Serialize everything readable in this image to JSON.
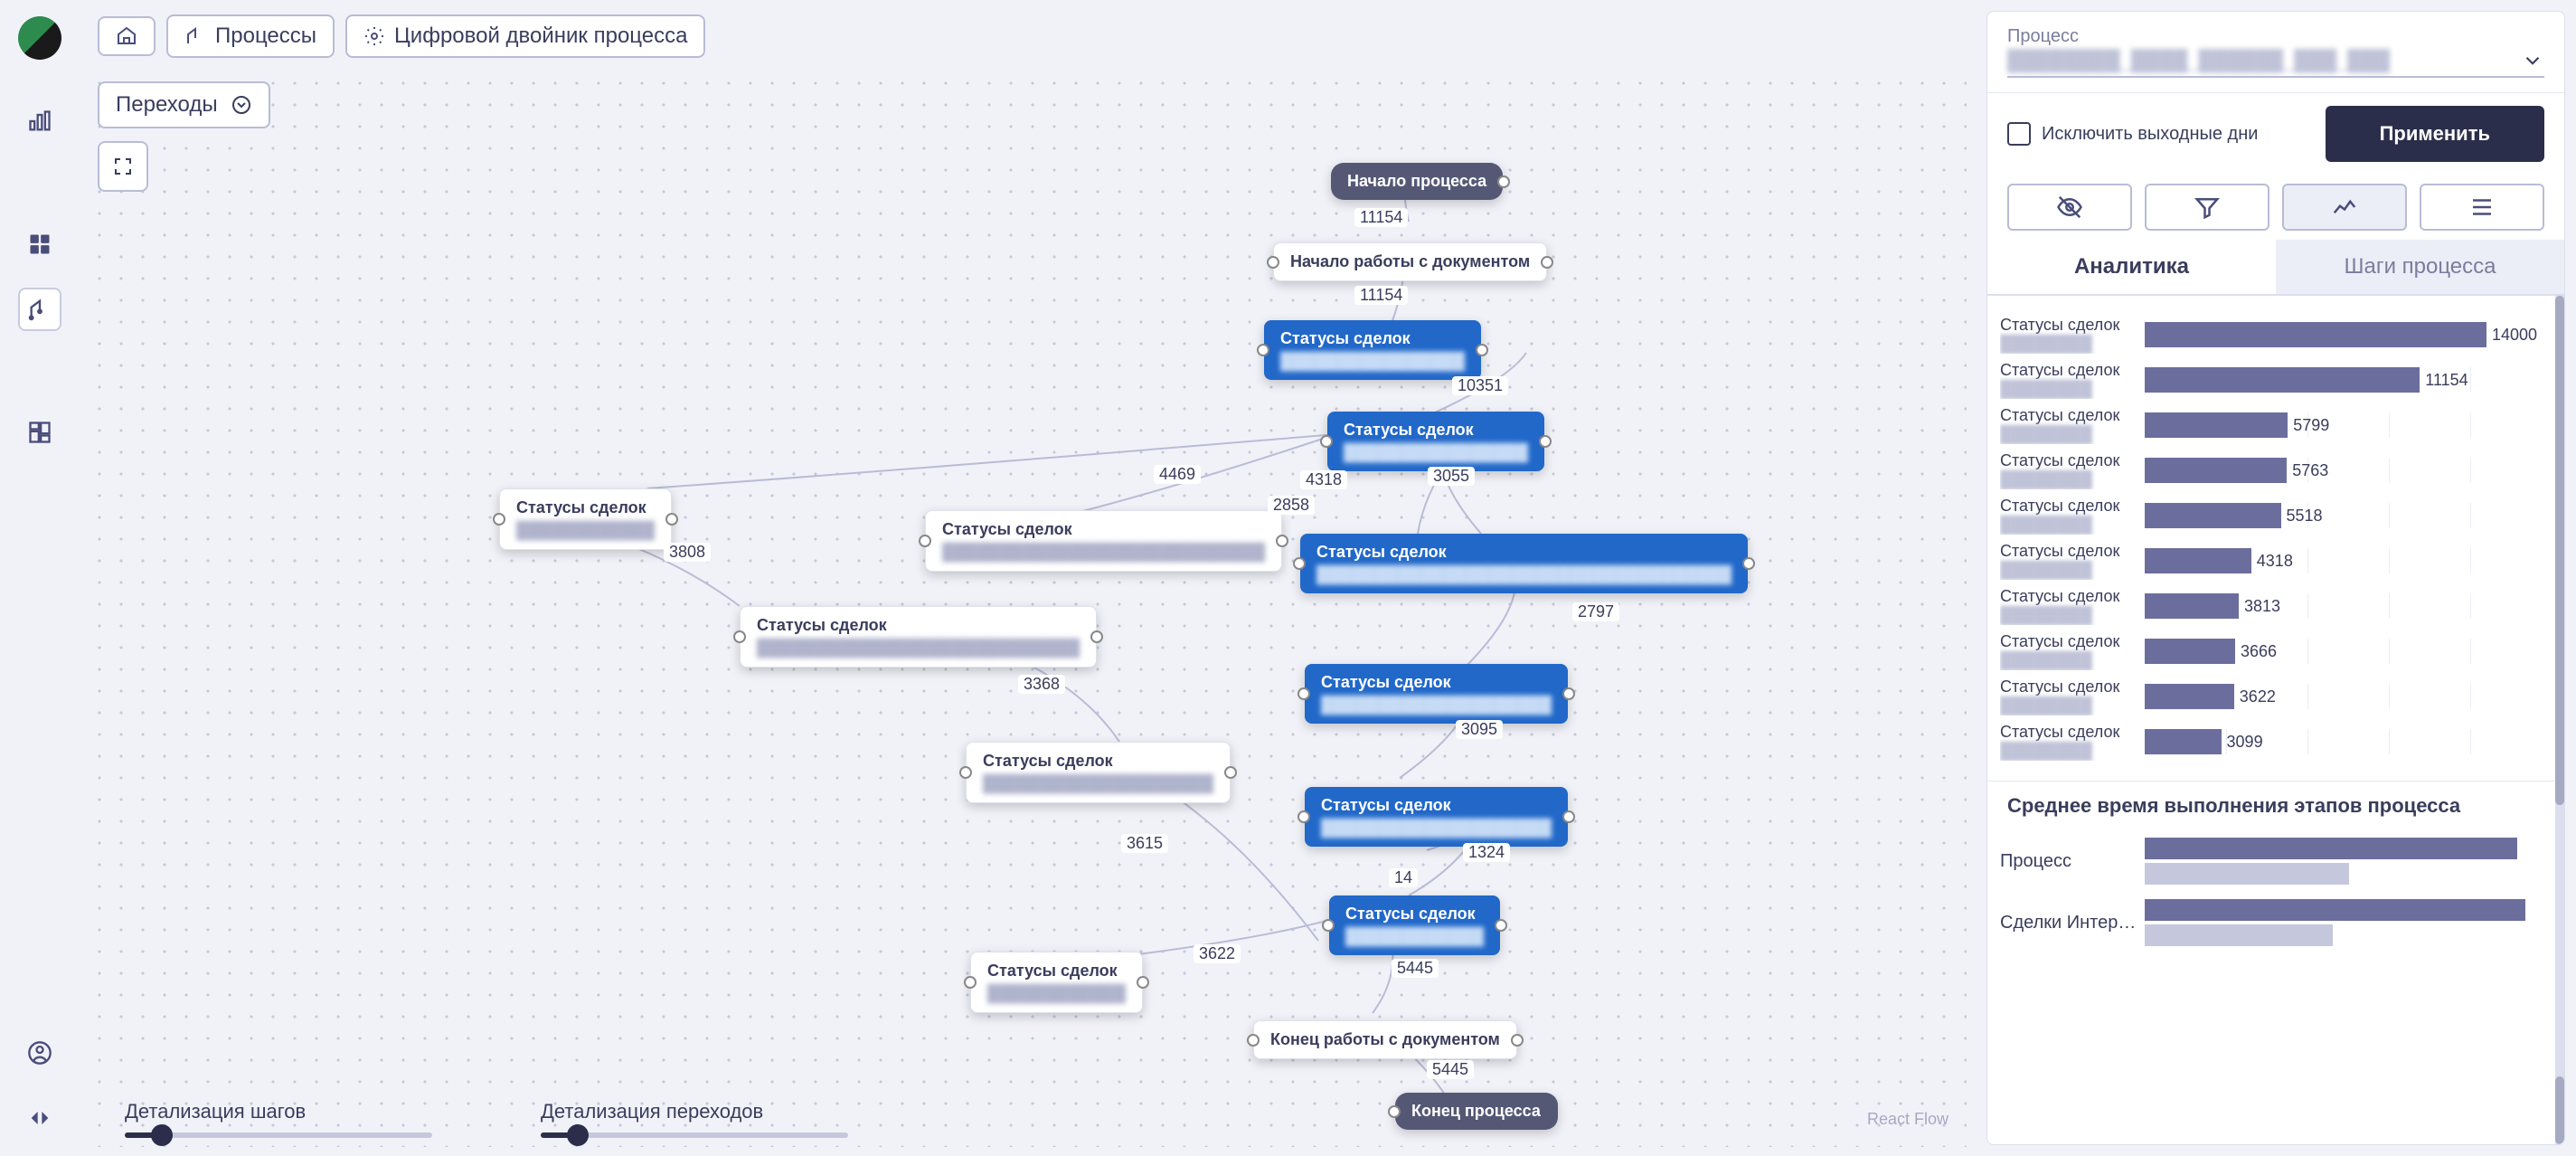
{
  "breadcrumbs": {
    "processes": "Процессы",
    "digital_twin": "Цифровой двойник процесса"
  },
  "canvas": {
    "transitions_label": "Переходы",
    "attribution": "React Flow"
  },
  "sliders": {
    "steps_label": "Детализация шагов",
    "steps_pct": 12,
    "transitions_label": "Детализация переходов",
    "transitions_pct": 12
  },
  "nodes": {
    "start": {
      "title": "Начало процесса"
    },
    "doc_start": {
      "title": "Начало работы с документом"
    },
    "deal1": {
      "title": "Статусы сделок",
      "sub": "████████████████"
    },
    "deal2": {
      "title": "Статусы сделок",
      "sub": "████████████████"
    },
    "deal3_w": {
      "title": "Статусы сделок",
      "sub": "████████████████████████████"
    },
    "deal4_wide": {
      "title": "Статусы сделок",
      "sub": "████████████████████████████████████"
    },
    "deal_left1": {
      "title": "Статусы сделок",
      "sub": "████████████"
    },
    "deal_left2": {
      "title": "Статусы сделок",
      "sub": "████████████████████████████"
    },
    "deal5": {
      "title": "Статусы сделок",
      "sub": "████████████████████"
    },
    "deal6_w": {
      "title": "Статусы сделок",
      "sub": "████████████████████"
    },
    "deal7": {
      "title": "Статусы сделок",
      "sub": "████████████████████"
    },
    "deal8": {
      "title": "Статусы сделок",
      "sub": "████████████"
    },
    "deal9_w": {
      "title": "Статусы сделок",
      "sub": "████████████"
    },
    "doc_end": {
      "title": "Конец работы с документом"
    },
    "end": {
      "title": "Конец процесса"
    }
  },
  "edges": {
    "e1": "11154",
    "e2": "11154",
    "e3": "10351",
    "e4": "4469",
    "e5": "4318",
    "e6": "3055",
    "e7": "2858",
    "e8": "3808",
    "e9": "2797",
    "e10": "3368",
    "e11": "3095",
    "e12": "3615",
    "e13": "1324",
    "e14": "14",
    "e15": "3622",
    "e16": "5445",
    "e17": "5445"
  },
  "panel": {
    "process_label": "Процесс",
    "process_value": "████████_████_██████_███_███",
    "exclude_label": "Исключить выходные дни",
    "apply_label": "Применить",
    "tab_analytics": "Аналитика",
    "tab_steps": "Шаги процесса",
    "sub_chart_title": "Среднее время выполнения этапов процесса",
    "stacked": {
      "r1": "Процесс",
      "r2": "Сделки Интерне..."
    }
  },
  "chart_data": {
    "type": "bar",
    "title": "",
    "orientation": "horizontal",
    "xlabel": "",
    "ylabel": "",
    "xlim": [
      0,
      14000
    ],
    "categories": [
      "Статусы сделок",
      "Статусы сделок",
      "Статусы сделок",
      "Статусы сделок",
      "Статусы сделок",
      "Статусы сделок",
      "Статусы сделок",
      "Статусы сделок",
      "Статусы сделок",
      "Статусы сделок"
    ],
    "values": [
      14000,
      11154,
      5799,
      5763,
      5518,
      4318,
      3813,
      3666,
      3622,
      3099
    ]
  }
}
